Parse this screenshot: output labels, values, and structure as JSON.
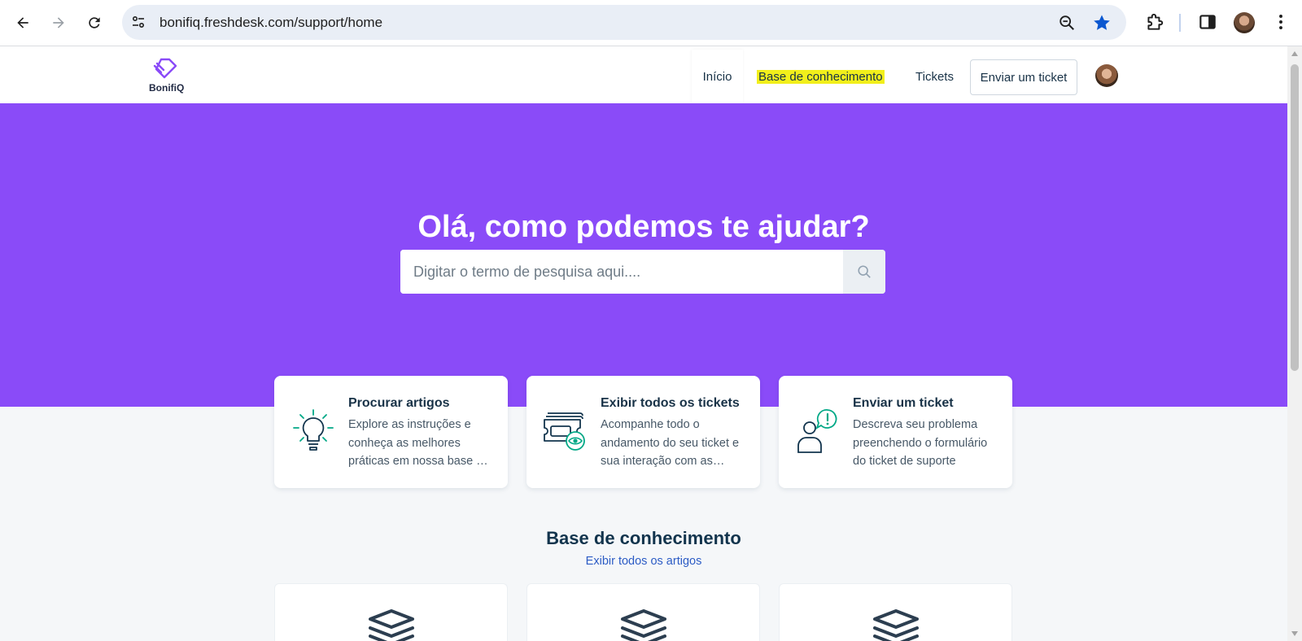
{
  "browser": {
    "url": "bonifiq.freshdesk.com/support/home"
  },
  "brand": {
    "name": "BonifiQ",
    "accent": "#8a4bf8",
    "highlight": "#f2ef1b"
  },
  "nav": {
    "home": "Início",
    "knowledge_base": "Base de conhecimento",
    "tickets": "Tickets",
    "submit_ticket": "Enviar um ticket"
  },
  "hero": {
    "title": "Olá, como podemos te ajudar?",
    "search_placeholder": "Digitar o termo de pesquisa aqui...."
  },
  "cards": [
    {
      "title": "Procurar artigos",
      "description": "Explore as instruções e conheça as melhores práticas em nossa base …",
      "icon": "lightbulb-icon"
    },
    {
      "title": "Exibir todos os tickets",
      "description": "Acompanhe todo o andamento do seu ticket e sua interação com as…",
      "icon": "tickets-eye-icon"
    },
    {
      "title": "Enviar um ticket",
      "description": "Descreva seu problema preenchendo o formulário do ticket de suporte",
      "icon": "person-alert-icon"
    }
  ],
  "knowledge_base": {
    "title": "Base de conhecimento",
    "view_all": "Exibir todos os artigos",
    "category_icon": "layers-icon"
  }
}
